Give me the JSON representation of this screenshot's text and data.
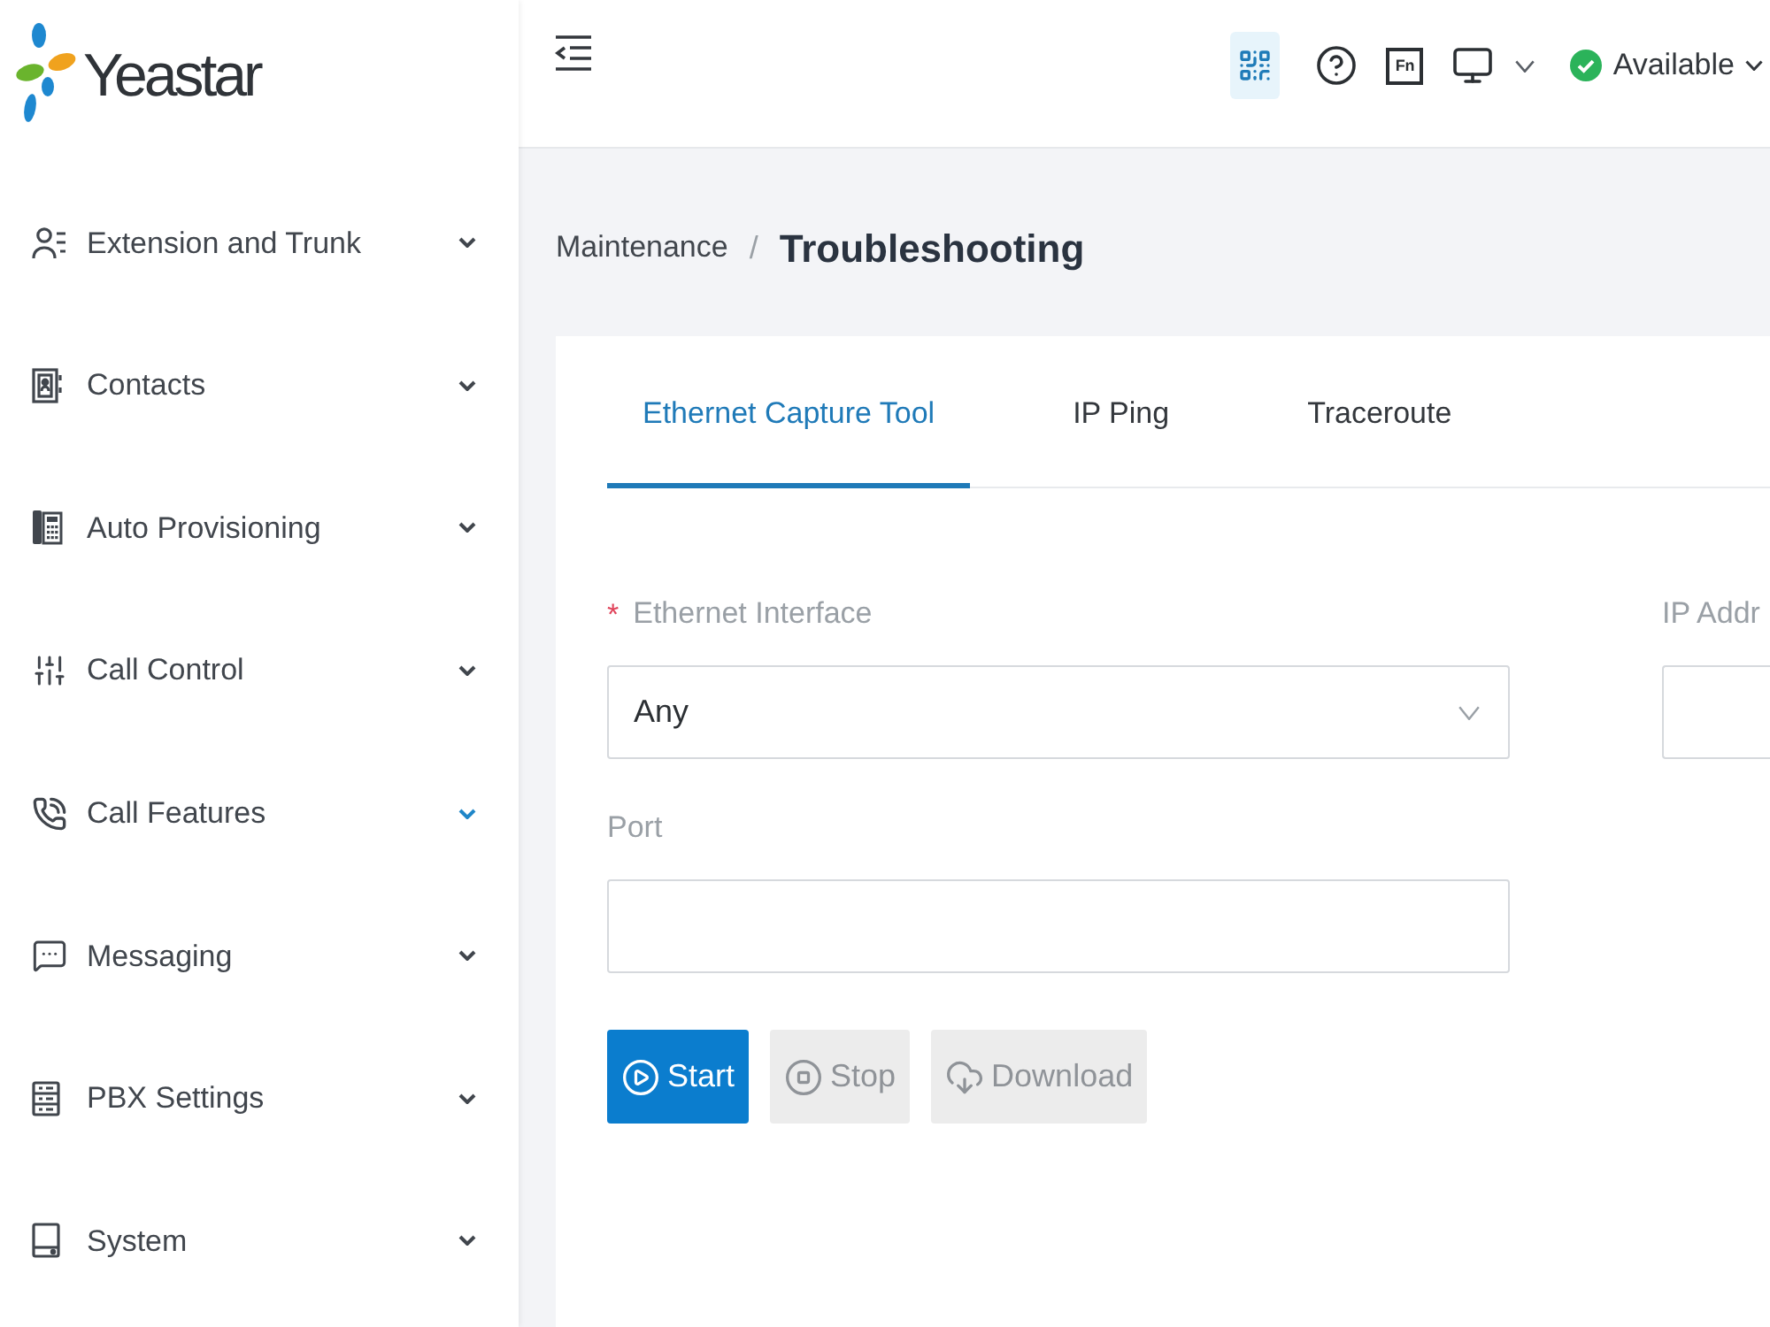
{
  "logo": {
    "text": "Yeastar"
  },
  "sidebar": {
    "items": [
      {
        "label": "Extension and Trunk",
        "hovered": false
      },
      {
        "label": "Contacts",
        "hovered": false
      },
      {
        "label": "Auto Provisioning",
        "hovered": false
      },
      {
        "label": "Call Control",
        "hovered": false
      },
      {
        "label": "Call Features",
        "hovered": true
      },
      {
        "label": "Messaging",
        "hovered": false
      },
      {
        "label": "PBX Settings",
        "hovered": false
      },
      {
        "label": "System",
        "hovered": false
      }
    ]
  },
  "header": {
    "fn_key": "Fn",
    "status": {
      "label": "Available"
    }
  },
  "breadcrumb": {
    "separator": "/",
    "items": [
      {
        "label": "Maintenance",
        "current": false
      },
      {
        "label": "Troubleshooting",
        "current": true
      }
    ]
  },
  "tabs": [
    {
      "label": "Ethernet Capture Tool",
      "selected": true
    },
    {
      "label": "IP Ping",
      "selected": false
    },
    {
      "label": "Traceroute",
      "selected": false
    }
  ],
  "form": {
    "required_mark": "*",
    "fields": [
      {
        "kind": "select",
        "label": "Ethernet Interface",
        "required": true,
        "value": "Any"
      },
      {
        "kind": "input",
        "label": "IP Addr",
        "required": false
      },
      {
        "kind": "input",
        "label": "Port",
        "required": false
      }
    ]
  },
  "buttons": [
    {
      "label": "Start",
      "disabled": false
    },
    {
      "label": "Stop",
      "disabled": true
    },
    {
      "label": "Download",
      "disabled": true
    }
  ]
}
